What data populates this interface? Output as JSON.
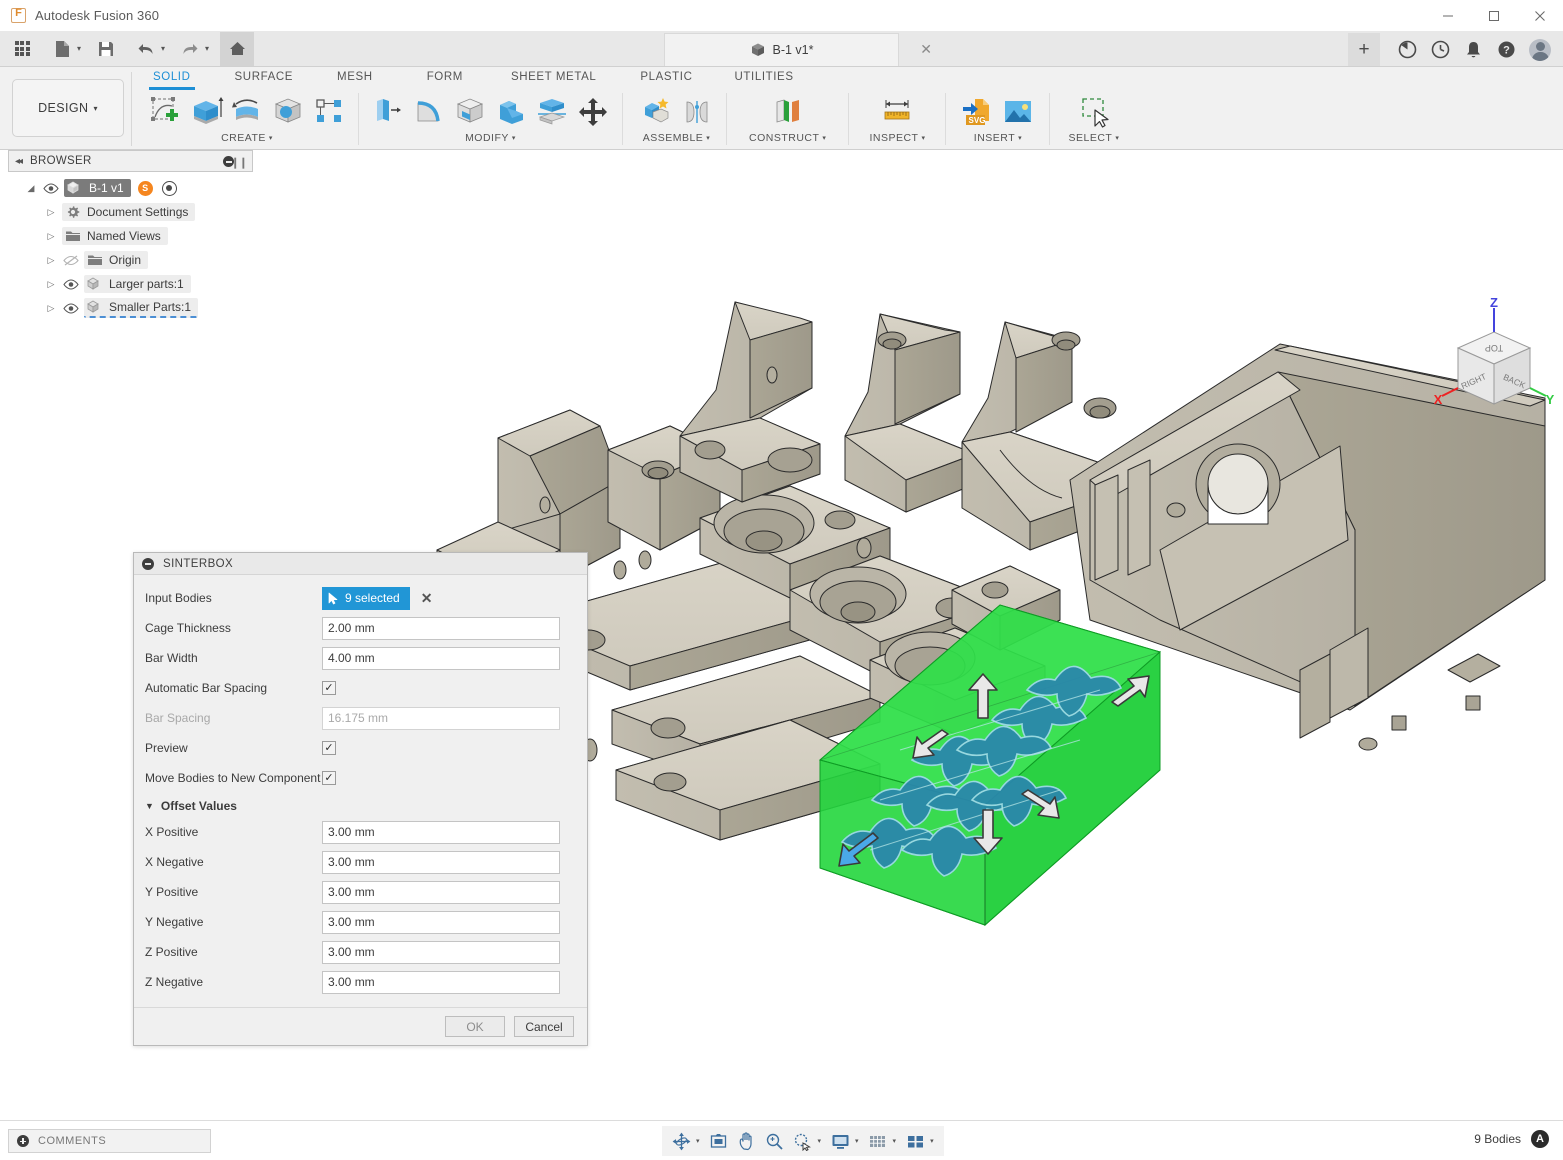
{
  "window": {
    "app_title": "Autodesk Fusion 360",
    "logo_icon": "fusion-logo-icon",
    "minimize": "–",
    "maximize": "□",
    "close": "✕"
  },
  "quick_access": {
    "items": [
      {
        "name": "app-grid-icon",
        "glyph": ""
      },
      {
        "name": "new-file-icon",
        "glyph": ""
      },
      {
        "name": "save-icon",
        "glyph": ""
      },
      {
        "name": "undo-icon",
        "glyph": "↶"
      },
      {
        "name": "redo-icon",
        "glyph": "↷"
      },
      {
        "name": "home-icon",
        "glyph": "⌂"
      }
    ],
    "caret": "▾"
  },
  "document_tab": {
    "label": "B-1 v1*",
    "cube_icon": "solid-cube-icon",
    "close": "✕",
    "new_tab": "+"
  },
  "top_right_icons": [
    {
      "name": "job-status-icon",
      "glyph": "◔"
    },
    {
      "name": "recent-activity-icon",
      "glyph": "◴"
    },
    {
      "name": "notifications-bell-icon",
      "glyph": "⌂"
    },
    {
      "name": "help-icon",
      "glyph": "?"
    },
    {
      "name": "account-avatar",
      "glyph": ""
    }
  ],
  "ribbon": {
    "design_workspace": "DESIGN",
    "design_caret": "▾",
    "tabs": [
      {
        "label": "SOLID",
        "active": true
      },
      {
        "label": "SURFACE",
        "active": false
      },
      {
        "label": "MESH",
        "active": false
      },
      {
        "label": "FORM",
        "active": false
      },
      {
        "label": "SHEET METAL",
        "active": false
      },
      {
        "label": "PLASTIC",
        "active": false
      },
      {
        "label": "UTILITIES",
        "active": false
      }
    ],
    "panels": [
      {
        "label": "CREATE",
        "caret": "▾",
        "icons": [
          "create-sketch-icon",
          "extrude-icon",
          "revolve-icon",
          "sphere-icon",
          "pattern-icon"
        ]
      },
      {
        "label": "MODIFY",
        "caret": "▾",
        "icons": [
          "press-pull-icon",
          "fillet-icon",
          "shell-icon",
          "combine-icon",
          "split-body-icon",
          "move-copy-icon"
        ]
      },
      {
        "label": "ASSEMBLE",
        "caret": "▾",
        "icons": [
          "new-component-icon",
          "joint-icon"
        ]
      },
      {
        "label": "CONSTRUCT",
        "caret": "▾",
        "icons": [
          "offset-plane-icon"
        ]
      },
      {
        "label": "INSPECT",
        "caret": "▾",
        "icons": [
          "measure-icon"
        ]
      },
      {
        "label": "INSERT",
        "caret": "▾",
        "icons": [
          "insert-svg-icon",
          "insert-image-icon"
        ]
      },
      {
        "label": "SELECT",
        "caret": "▾",
        "icons": [
          "window-select-icon"
        ]
      }
    ]
  },
  "browser": {
    "title": "BROWSER",
    "collapse_icon": "◂◂",
    "minimize_icon": "browser-minimize-icon",
    "grip_icon": "❙❙",
    "tree": [
      {
        "label": "B-1 v1",
        "icon": "component-icon",
        "expander": "◢",
        "eye": "eye-visible-icon",
        "selected": true,
        "badge": "S",
        "radio": true,
        "indent": 0
      },
      {
        "label": "Document Settings",
        "icon": "gear-icon",
        "expander": "▷",
        "eye": "",
        "selected": false,
        "indent": 1
      },
      {
        "label": "Named Views",
        "icon": "folder-icon",
        "expander": "▷",
        "eye": "",
        "selected": false,
        "indent": 1
      },
      {
        "label": "Origin",
        "icon": "folder-icon",
        "expander": "▷",
        "eye": "eye-hidden-icon",
        "selected": false,
        "indent": 1
      },
      {
        "label": "Larger parts:1",
        "icon": "component-icon",
        "expander": "▷",
        "eye": "eye-visible-icon",
        "selected": false,
        "indent": 1
      },
      {
        "label": "Smaller Parts:1",
        "icon": "component-icon",
        "expander": "▷",
        "eye": "eye-visible-icon",
        "selected": false,
        "indent": 1,
        "underlined": true
      }
    ]
  },
  "dialog": {
    "title": "SINTERBOX",
    "minimize_icon": "dialog-minimize-icon",
    "input_bodies": {
      "label": "Input Bodies",
      "selection_text": "9 selected",
      "cursor_icon": "select-arrow-icon",
      "clear": "✕"
    },
    "fields": [
      {
        "label": "Cage Thickness",
        "value": "2.00 mm",
        "type": "text",
        "disabled": false
      },
      {
        "label": "Bar Width",
        "value": "4.00 mm",
        "type": "text",
        "disabled": false
      },
      {
        "label": "Automatic Bar Spacing",
        "value": "✓",
        "type": "checkbox",
        "checked": true,
        "disabled": false
      },
      {
        "label": "Bar Spacing",
        "value": "16.175 mm",
        "type": "text",
        "disabled": true
      },
      {
        "label": "Preview",
        "value": "✓",
        "type": "checkbox",
        "checked": true,
        "disabled": false
      },
      {
        "label": "Move Bodies to New Component",
        "value": "✓",
        "type": "checkbox",
        "checked": true,
        "disabled": false
      }
    ],
    "offset_section": {
      "caret": "▼",
      "title": "Offset Values",
      "fields": [
        {
          "label": "X Positive",
          "value": "3.00 mm"
        },
        {
          "label": "X Negative",
          "value": "3.00 mm"
        },
        {
          "label": "Y Positive",
          "value": "3.00 mm"
        },
        {
          "label": "Y Negative",
          "value": "3.00 mm"
        },
        {
          "label": "Z Positive",
          "value": "3.00 mm"
        },
        {
          "label": "Z Negative",
          "value": "3.00 mm"
        }
      ]
    },
    "ok_label": "OK",
    "cancel_label": "Cancel"
  },
  "viewcube": {
    "top_face": "TOP",
    "left_face": "RIGHT",
    "right_face": "BACK",
    "axis_x": "X",
    "axis_y": "Y",
    "axis_z": "Z",
    "color_x": "#ee2222",
    "color_y": "#33cc44",
    "color_z": "#4444dd"
  },
  "viewport": {
    "sinterbox_color": "#1fd93a",
    "body_color": "#cdc8bb",
    "selected_body_color": "#2a86ad"
  },
  "status_bar": {
    "comments_label": "COMMENTS",
    "bodies_count": "9 Bodies",
    "autodesk_badge": "A",
    "nav_tools": [
      {
        "name": "orbit-icon",
        "caret": true
      },
      {
        "name": "look-at-icon",
        "caret": false
      },
      {
        "name": "pan-icon",
        "caret": false
      },
      {
        "name": "zoom-icon",
        "caret": false
      },
      {
        "name": "zoom-window-icon",
        "caret": true
      },
      {
        "name": "display-settings-icon",
        "caret": true
      },
      {
        "name": "grid-snaps-icon",
        "caret": true
      },
      {
        "name": "viewports-icon",
        "caret": true
      }
    ]
  }
}
